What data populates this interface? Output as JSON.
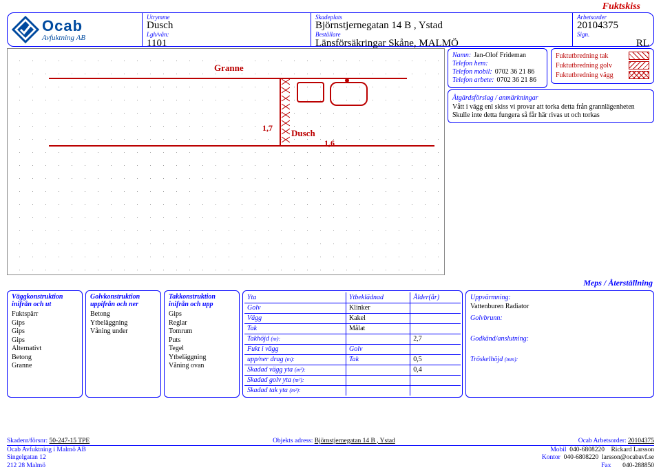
{
  "title_top": "Fuktskiss",
  "logo": {
    "name": "Ocab",
    "sub": "Avfuktning AB"
  },
  "header": {
    "c1a_lbl": "Utrymme",
    "c1a_val": "Dusch",
    "c1b_lbl": "Lgh/vån:",
    "c1b_val": "1101",
    "c2a_lbl": "Skadeplats",
    "c2a_val": "Björnstjernegatan 14 B , Ystad",
    "c2b_lbl": "Beställare",
    "c2b_val": "Länsförsäkringar Skåne, MALMÖ",
    "c3a_lbl": "Arbetsorder",
    "c3a_val": "20104375",
    "c3b_lbl": "Sign.",
    "c3b_val": "RL"
  },
  "sketch": {
    "label_granne": "Granne",
    "label_dusch": "Dusch",
    "num1": "1,7",
    "num2": "1,6"
  },
  "contact": {
    "namn_lbl": "Namn:",
    "namn": "Jan-Olof Frideman",
    "telhem_lbl": "Telefon hem:",
    "telmob_lbl": "Telefon mobil:",
    "telmob": "0702 36 21 86",
    "telarb_lbl": "Telefon arbete:",
    "telarb": "0702 36 21 86",
    "atg_hdr": "Åtgärdsförslag / anmärkningar",
    "atg_txt1": "Vått i vägg enl skiss vi provar att torka detta från grannlägenheten",
    "atg_txt2": "Skulle inte detta fungera så får här rivas ut och torkas"
  },
  "legend": {
    "r1": "Fuktutbredning tak",
    "r2": "Fuktutbredning golv",
    "r3": "Fuktutbredning vägg"
  },
  "meps": "Meps / Återställning",
  "col1": {
    "h1": "Väggkonstruktion",
    "h2": "inifrån och ut",
    "items": [
      "Fuktspärr",
      "Gips",
      "Gips",
      "Gips",
      "Alternativt",
      "Betong",
      "Granne"
    ]
  },
  "col2": {
    "h1": "Golvkonstruktion",
    "h2": "uppifrån och ner",
    "items": [
      "Betong",
      "Ytbeläggning",
      "Våning under"
    ]
  },
  "col3": {
    "h1": "Takkonstruktion",
    "h2": "inifrån och upp",
    "items": [
      "Gips",
      "Reglar",
      "Tomrum",
      "Puts",
      "Tegel",
      "Ytbeläggning",
      "Våning ovan"
    ]
  },
  "table": {
    "h_yta": "Yta",
    "h_ytb": "Ytbeklädnad",
    "h_ald": "Ålder(år)",
    "r_golv": "Golv",
    "v_golv": "Klinker",
    "r_vagg": "Vägg",
    "v_vagg": "Kakel",
    "r_tak": "Tak",
    "v_tak": "Målat",
    "r_takh": "Takhöjd",
    "u_m": "(m):",
    "v_takh": "2,7",
    "r_fukt": "Fukt i vägg",
    "v_fukt_g": "Golv",
    "r_upp": "upp/ner drag",
    "v_upp_t": "Tak",
    "v_upp": "0,5",
    "r_skv": "Skadad vägg yta",
    "u_m2": "(m²):",
    "v_skv": "0,4",
    "r_skg": "Skadad golv yta",
    "r_skt": "Skadad tak yta"
  },
  "right": {
    "h1": "Uppvärmning:",
    "v1": "Vattenburen Radiator",
    "h2": "Golvbrunn:",
    "h3": "Godkänd/anslutning:",
    "h4": "Tröskelhöjd",
    "u4": "(mm):"
  },
  "footer": {
    "skad_lbl": "Skadenr/försnr:",
    "skad": "50-247-15 TPE",
    "obj_lbl": "Objekts adress:",
    "obj": "Björnstjernegatan 14 B , Ystad",
    "arb_lbl": "Ocab Arbetsorder:",
    "arb": "20104375",
    "comp1": "Ocab Avfuktning i Malmö AB",
    "comp2": "Singelgatan 12",
    "comp3": "212 28 Malmö",
    "mob_lbl": "Mobil",
    "mob": "040-6808220",
    "kon_lbl": "Kontor",
    "kon": "040-6808220",
    "fax_lbl": "Fax",
    "fax": "040-288850",
    "person": "Rickard Larsson",
    "email": "larsson@ocabavf.se"
  }
}
